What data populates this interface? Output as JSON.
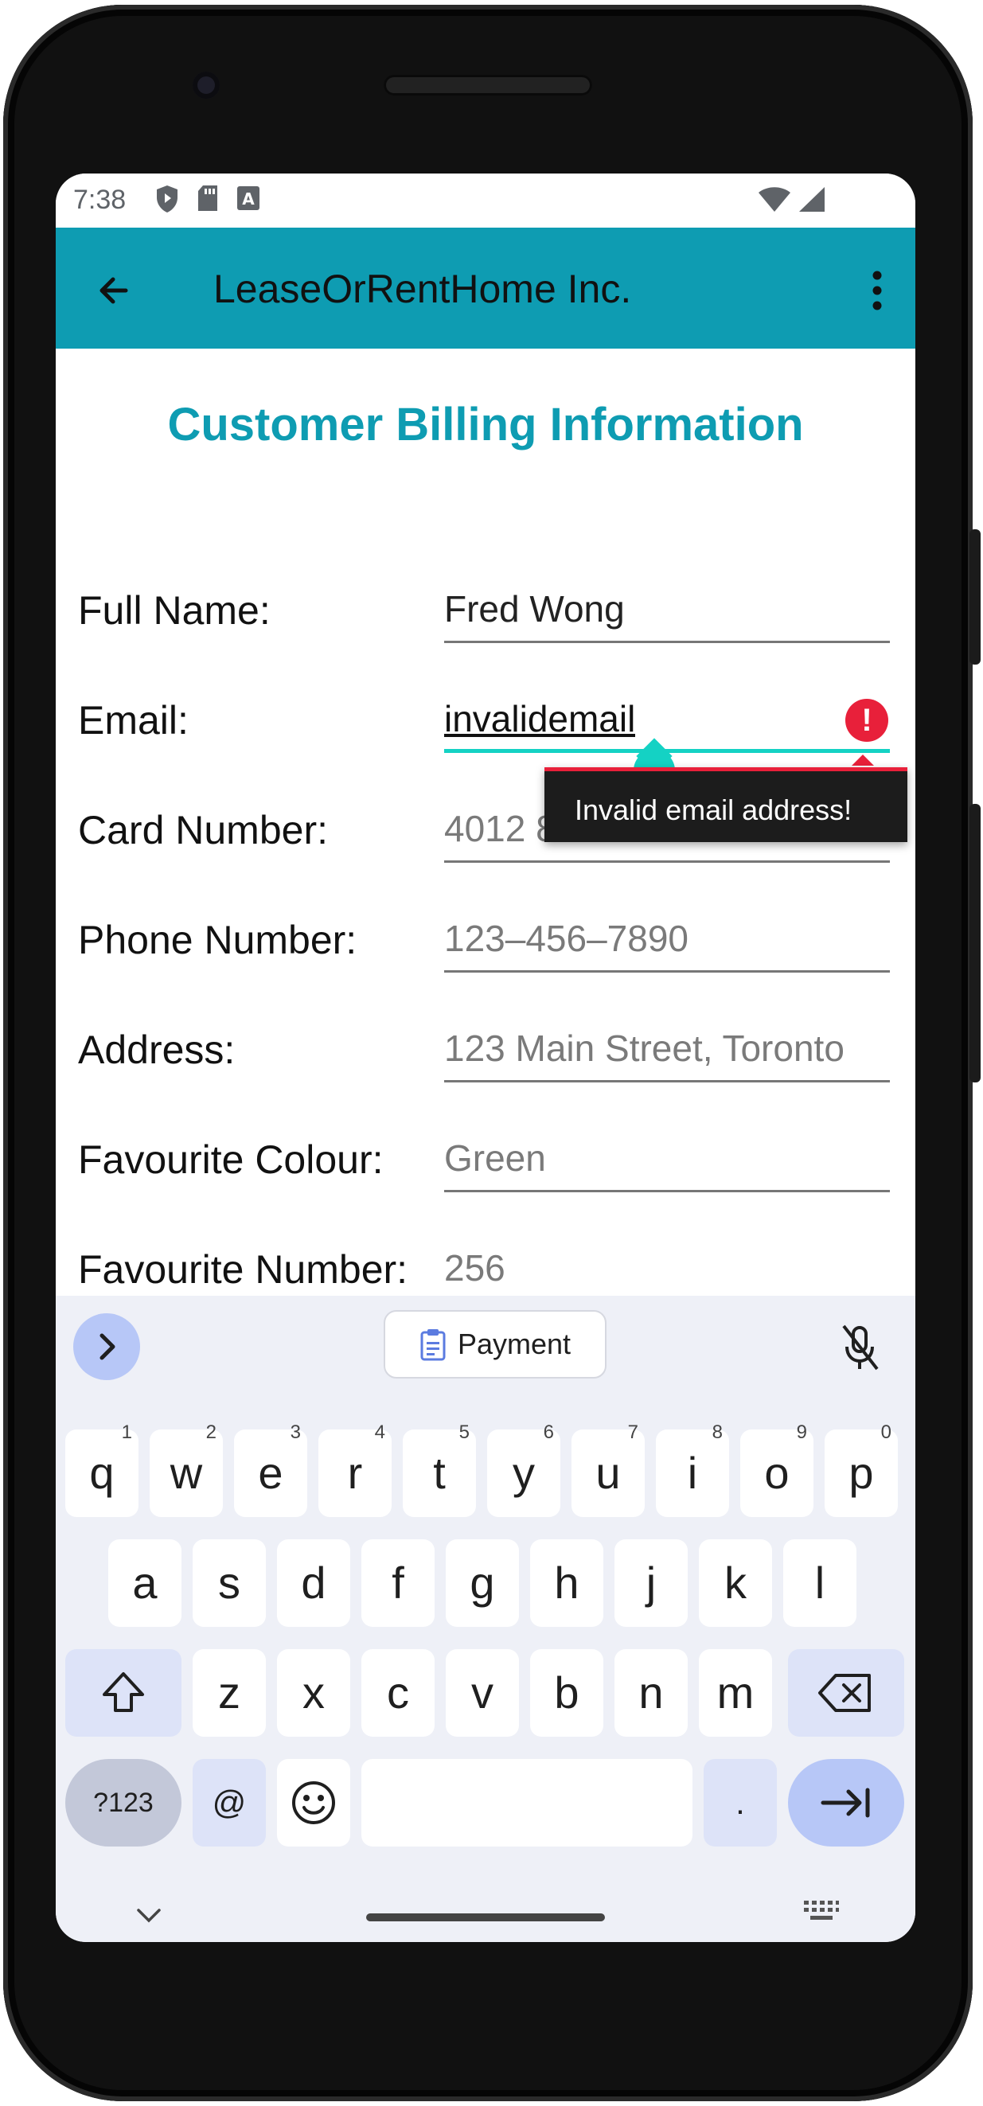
{
  "status_bar": {
    "time": "7:38",
    "left_icons": [
      "shield-play-icon",
      "sd-card-icon",
      "text-a-icon"
    ],
    "right_icons": [
      "wifi-icon",
      "signal-icon"
    ]
  },
  "app_bar": {
    "title": "LeaseOrRentHome Inc.",
    "back_icon": "arrow-back-icon",
    "menu_icon": "more-vert-icon",
    "color": "#0e9cb2"
  },
  "form": {
    "heading": "Customer Billing Information",
    "fields": [
      {
        "label": "Full Name:",
        "value": "Fred Wong",
        "placeholder": ""
      },
      {
        "label": "Email:",
        "value": "invalidemail",
        "placeholder": ""
      },
      {
        "label": "Card Number:",
        "value": "",
        "placeholder": "4012 8888 8888 1881"
      },
      {
        "label": "Phone Number:",
        "value": "",
        "placeholder": "123–456–7890"
      },
      {
        "label": "Address:",
        "value": "",
        "placeholder": "123 Main Street, Toronto"
      },
      {
        "label": "Favourite Colour:",
        "value": "",
        "placeholder": "Green"
      },
      {
        "label": "Favourite Number:",
        "value": "",
        "placeholder": "256"
      }
    ],
    "error": {
      "message": "Invalid email address!",
      "color": "#e8203a"
    }
  },
  "keyboard": {
    "suggestion": "Payment",
    "row1": [
      {
        "key": "q",
        "hint": "1"
      },
      {
        "key": "w",
        "hint": "2"
      },
      {
        "key": "e",
        "hint": "3"
      },
      {
        "key": "r",
        "hint": "4"
      },
      {
        "key": "t",
        "hint": "5"
      },
      {
        "key": "y",
        "hint": "6"
      },
      {
        "key": "u",
        "hint": "7"
      },
      {
        "key": "i",
        "hint": "8"
      },
      {
        "key": "o",
        "hint": "9"
      },
      {
        "key": "p",
        "hint": "0"
      }
    ],
    "row2": [
      "a",
      "s",
      "d",
      "f",
      "g",
      "h",
      "j",
      "k",
      "l"
    ],
    "row3": [
      "z",
      "x",
      "c",
      "v",
      "b",
      "n",
      "m"
    ],
    "symbols_label": "?123",
    "at_label": "@",
    "period_label": "."
  }
}
